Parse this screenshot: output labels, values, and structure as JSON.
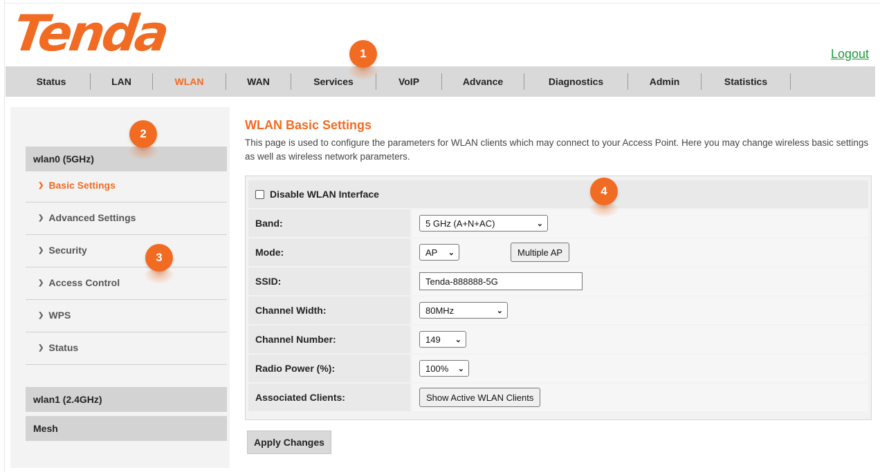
{
  "brand": {
    "logo_text": "Tenda",
    "accent": "#f26b22",
    "link_color": "#1f9a3a"
  },
  "header": {
    "logout": "Logout"
  },
  "topnav": {
    "tabs": [
      {
        "label": "Status"
      },
      {
        "label": "LAN"
      },
      {
        "label": "WLAN",
        "active": true
      },
      {
        "label": "WAN"
      },
      {
        "label": "Services"
      },
      {
        "label": "VoIP"
      },
      {
        "label": "Advance"
      },
      {
        "label": "Diagnostics"
      },
      {
        "label": "Admin"
      },
      {
        "label": "Statistics"
      }
    ]
  },
  "sidebar": {
    "group1": "wlan0 (5GHz)",
    "items": [
      {
        "label": "Basic Settings",
        "active": true
      },
      {
        "label": "Advanced Settings"
      },
      {
        "label": "Security"
      },
      {
        "label": "Access Control"
      },
      {
        "label": "WPS"
      },
      {
        "label": "Status"
      }
    ],
    "group2": "wlan1 (2.4GHz)",
    "group3": "Mesh",
    "item_marker": "chevron-right-icon"
  },
  "main": {
    "title": "WLAN Basic Settings",
    "description": "This page is used to configure the parameters for WLAN clients which may connect to your Access Point. Here you may change wireless basic settings as well as wireless network parameters.",
    "disable_label": "Disable WLAN Interface",
    "disable_checked": false,
    "band": {
      "label": "Band:",
      "value": "5 GHz (A+N+AC)"
    },
    "mode": {
      "label": "Mode:",
      "value": "AP",
      "multiple_ap": "Multiple AP"
    },
    "ssid": {
      "label": "SSID:",
      "value": "Tenda-888888-5G"
    },
    "channel_width": {
      "label": "Channel Width:",
      "value": "80MHz"
    },
    "channel_number": {
      "label": "Channel Number:",
      "value": "149"
    },
    "radio_power": {
      "label": "Radio Power (%):",
      "value": "100%"
    },
    "clients": {
      "label": "Associated Clients:",
      "button": "Show Active WLAN Clients"
    },
    "apply": "Apply Changes"
  },
  "markers": [
    "1",
    "2",
    "3",
    "4"
  ]
}
